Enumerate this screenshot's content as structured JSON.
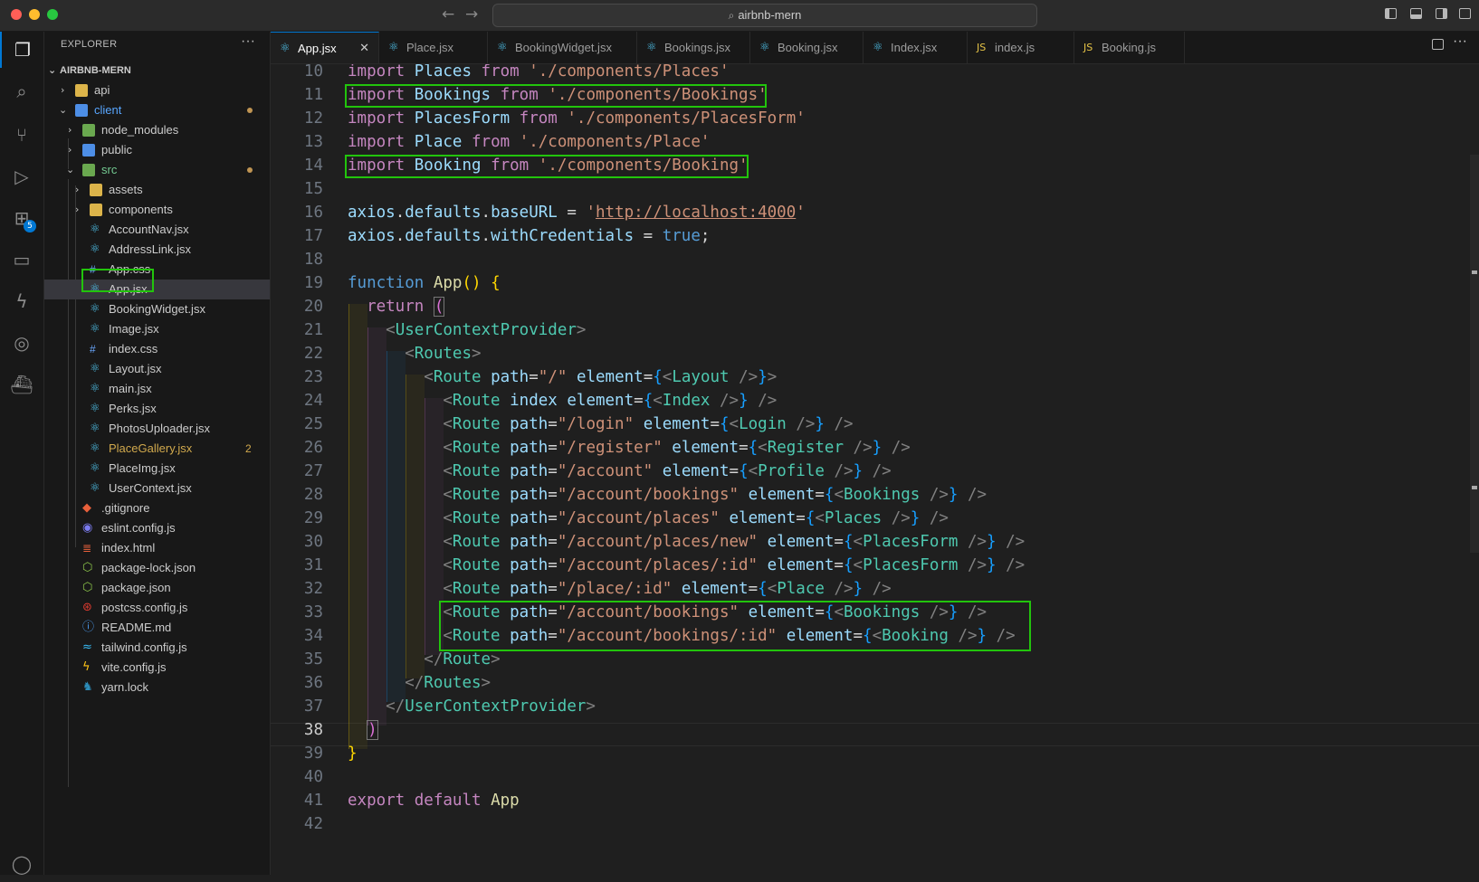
{
  "window": {
    "title": "airbnb-mern",
    "back_icon": "arrow-left-icon",
    "forward_icon": "arrow-right-icon"
  },
  "activity_bar": {
    "items": [
      "explorer-icon",
      "search-icon",
      "source-control-icon",
      "run-debug-icon",
      "extensions-icon",
      "remote-explorer-icon",
      "thunder-client-icon",
      "gitlens-icon",
      "docker-icon",
      "account-icon"
    ],
    "extensions_badge": "5"
  },
  "sidebar": {
    "title": "EXPLORER",
    "more": "···",
    "root": "AIRBNB-MERN",
    "items": [
      {
        "label": "api"
      },
      {
        "label": "client"
      },
      {
        "label": "node_modules"
      },
      {
        "label": "public"
      },
      {
        "label": "src"
      },
      {
        "label": "assets"
      },
      {
        "label": "components"
      },
      {
        "label": "AccountNav.jsx"
      },
      {
        "label": "AddressLink.jsx"
      },
      {
        "label": "App.css"
      },
      {
        "label": "App.jsx"
      },
      {
        "label": "BookingWidget.jsx"
      },
      {
        "label": "Image.jsx"
      },
      {
        "label": "index.css"
      },
      {
        "label": "Layout.jsx"
      },
      {
        "label": "main.jsx"
      },
      {
        "label": "Perks.jsx"
      },
      {
        "label": "PhotosUploader.jsx"
      },
      {
        "label": "PlaceGallery.jsx",
        "problems": "2"
      },
      {
        "label": "PlaceImg.jsx"
      },
      {
        "label": "UserContext.jsx"
      },
      {
        "label": ".gitignore"
      },
      {
        "label": "eslint.config.js"
      },
      {
        "label": "index.html"
      },
      {
        "label": "package-lock.json"
      },
      {
        "label": "package.json"
      },
      {
        "label": "postcss.config.js"
      },
      {
        "label": "README.md"
      },
      {
        "label": "tailwind.config.js"
      },
      {
        "label": "vite.config.js"
      },
      {
        "label": "yarn.lock"
      }
    ]
  },
  "tabs": [
    {
      "label": "App.jsx",
      "close": "✕"
    },
    {
      "label": "Place.jsx"
    },
    {
      "label": "BookingWidget.jsx"
    },
    {
      "label": "Bookings.jsx"
    },
    {
      "label": "Booking.jsx"
    },
    {
      "label": "Index.jsx"
    },
    {
      "label": "index.js"
    },
    {
      "label": "Booking.js"
    }
  ],
  "editor": {
    "line_numbers": [
      "10",
      "11",
      "12",
      "13",
      "14",
      "15",
      "16",
      "17",
      "18",
      "19",
      "20",
      "21",
      "22",
      "23",
      "24",
      "25",
      "26",
      "27",
      "28",
      "29",
      "30",
      "31",
      "32",
      "33",
      "34",
      "35",
      "36",
      "37",
      "38",
      "39",
      "40",
      "41",
      "42"
    ],
    "current_line": "38",
    "code": {
      "l10": {
        "import": "import",
        "name": "Places",
        "from": "from",
        "path": "'./components/Places'"
      },
      "l11": {
        "import": "import",
        "name": "Bookings",
        "from": "from",
        "path": "'./components/Bookings'"
      },
      "l12": {
        "import": "import",
        "name": "PlacesForm",
        "from": "from",
        "path": "'./components/PlacesForm'"
      },
      "l13": {
        "import": "import",
        "name": "Place",
        "from": "from",
        "path": "'./components/Place'"
      },
      "l14": {
        "import": "import",
        "name": "Booking",
        "from": "from",
        "path": "'./components/Booking'"
      },
      "l16": {
        "obj": "axios",
        "p1": "defaults",
        "p2": "baseURL",
        "eq": " = ",
        "q1": "'",
        "url": "http://localhost:4000",
        "q2": "'"
      },
      "l17": {
        "obj": "axios",
        "p1": "defaults",
        "p2": "withCredentials",
        "eq": " = ",
        "val": "true",
        "semi": ";"
      },
      "l19": {
        "kw": "function",
        "name": "App",
        "parens": "()",
        "brace": "{"
      },
      "l20": {
        "kw": "return",
        "paren": "("
      },
      "l21": {
        "tag": "UserContextProvider"
      },
      "l22": {
        "tag": "Routes"
      },
      "l23": {
        "tag": "Route",
        "attr": "path",
        "val": "\"/\"",
        "attr2": "element",
        "comp": "Layout"
      },
      "l24": {
        "tag": "Route",
        "attr": "index",
        "attr2": "element",
        "comp": "Index"
      },
      "l25": {
        "tag": "Route",
        "attr": "path",
        "val": "\"/login\"",
        "attr2": "element",
        "comp": "Login"
      },
      "l26": {
        "tag": "Route",
        "attr": "path",
        "val": "\"/register\"",
        "attr2": "element",
        "comp": "Register"
      },
      "l27": {
        "tag": "Route",
        "attr": "path",
        "val": "\"/account\"",
        "attr2": "element",
        "comp": "Profile"
      },
      "l28": {
        "tag": "Route",
        "attr": "path",
        "val": "\"/account/bookings\"",
        "attr2": "element",
        "comp": "Bookings"
      },
      "l29": {
        "tag": "Route",
        "attr": "path",
        "val": "\"/account/places\"",
        "attr2": "element",
        "comp": "Places"
      },
      "l30": {
        "tag": "Route",
        "attr": "path",
        "val": "\"/account/places/new\"",
        "attr2": "element",
        "comp": "PlacesForm"
      },
      "l31": {
        "tag": "Route",
        "attr": "path",
        "val": "\"/account/places/:id\"",
        "attr2": "element",
        "comp": "PlacesForm"
      },
      "l32": {
        "tag": "Route",
        "attr": "path",
        "val": "\"/place/:id\"",
        "attr2": "element",
        "comp": "Place"
      },
      "l33": {
        "tag": "Route",
        "attr": "path",
        "val": "\"/account/bookings\"",
        "attr2": "element",
        "comp": "Bookings"
      },
      "l34": {
        "tag": "Route",
        "attr": "path",
        "val": "\"/account/bookings/:id\"",
        "attr2": "element",
        "comp": "Booking"
      },
      "l35": {
        "tag": "Route"
      },
      "l36": {
        "tag": "Routes"
      },
      "l37": {
        "tag": "UserContextProvider"
      },
      "l38": {
        "paren": ")"
      },
      "l39": {
        "brace": "}"
      },
      "l41": {
        "kw1": "export",
        "kw2": "default",
        "name": "App"
      }
    }
  },
  "colors": {
    "highlight_box": "#22c40c",
    "accent": "#0078d4"
  }
}
